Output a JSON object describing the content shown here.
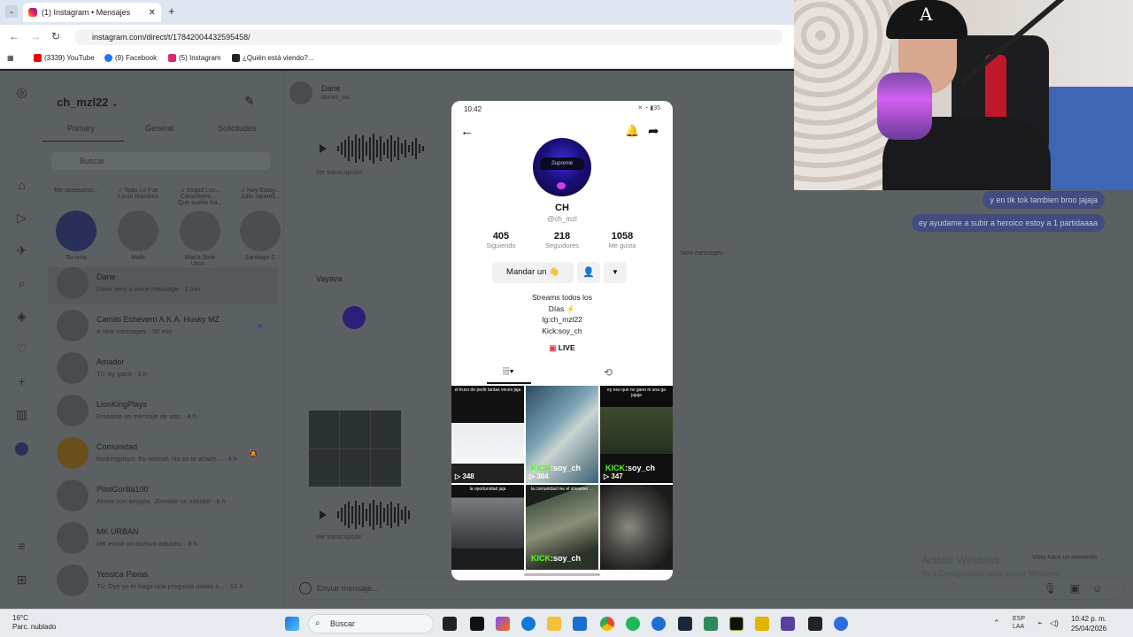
{
  "browser": {
    "tab_title": "(1) Instagram • Mensajes",
    "url": "instagram.com/direct/t/17842004432595458/",
    "bookmarks": [
      "(3339) YouTube",
      "(9) Facebook",
      "(5) Instagram",
      "¿Quién está viendo?..."
    ]
  },
  "instagram": {
    "account": "ch_mzl22",
    "tabs": [
      "Primary",
      "General",
      "Solicitudes"
    ],
    "search_placeholder": "Buscar",
    "notes": [
      {
        "bubble": "Me obsesiono...",
        "name": "Tu nota"
      },
      {
        "bubble": "♫ Todo Lo Fue Lenin Ramírez",
        "name": "Mafe"
      },
      {
        "bubble": "♫ Stupid Lov... Carselbero, ... Que sueño tra...",
        "name": "María José Urco..."
      },
      {
        "bubble": "♫ Hoy Estoy... Julio Jaramil...",
        "name": "Santiago C"
      }
    ],
    "conversations": [
      {
        "name": "Dane",
        "preview": "Dane sent a voice message · 1 min",
        "unread": false
      },
      {
        "name": "Camilo Echeverri A.K.A. Husky MZ",
        "preview": "4 new messages · 50 min",
        "unread": true
      },
      {
        "name": "Amador",
        "preview": "Tú: Ay gano · 3 h",
        "unread": false
      },
      {
        "name": "LionKingPlays",
        "preview": "Enviaste un mensaje de voz. · 4 h",
        "unread": false
      },
      {
        "name": "Comunidad",
        "preview": "lionkingplays: Es normal. No se le añade... · 4 h",
        "unread": false
      },
      {
        "name": "PilotGorilla100",
        "preview": "Ahora son amigos. ¡Envíale un saludo! · 6 h",
        "unread": false
      },
      {
        "name": "MK URBAN",
        "preview": "MK envió un archivo adjunto. · 8 h",
        "unread": false
      },
      {
        "name": "Yessica Pavas",
        "preview": "Tú: Oye yo te hago una pregunta quitas s... · 12 h",
        "unread": false
      }
    ],
    "chat": {
      "name": "Dane",
      "subtitle": "danez_wo",
      "transcription": "Ver transcripción",
      "sent_messages": [
        "y en tik tok tambien broo jajaja",
        "ey ayudame a subir a heroico estoy a 1 partidaaaa"
      ],
      "new_messages": "New messages",
      "shared_profile_label": "Vayava",
      "input_placeholder": "Enviar mensaje..."
    },
    "windows_watermark": {
      "line1": "Activar Windows",
      "line2": "Ve a Configuración para activar Windows.",
      "side": "Visto hace un momento"
    }
  },
  "phone": {
    "time": "10:42",
    "battery": "35",
    "name": "CH",
    "handle": "@ch_mzl",
    "stats": [
      {
        "value": "405",
        "label": "Siguiendo"
      },
      {
        "value": "218",
        "label": "Seguidores"
      },
      {
        "value": "1058",
        "label": "Me gusta"
      }
    ],
    "message_button": "Mandar un 👋",
    "bio": [
      "Streams todos los",
      "Días ⚡",
      "Ig:ch_mzl22",
      "Kick:soy_ch"
    ],
    "live_label": "LIVE",
    "avatar_text": "Supreme",
    "videos": [
      {
        "caption": "el truco de pedir tantas veces jaja",
        "views": "348",
        "kick": ""
      },
      {
        "caption": "",
        "views": "304",
        "kick": ":soy_ch"
      },
      {
        "caption": "ey eso que no gano ni una ga jajaja",
        "views": "347",
        "kick": ":soy_ch"
      },
      {
        "caption": "la oportunidad jaja",
        "views": "",
        "kick": ""
      },
      {
        "caption": "la comunidad me el streamer ...",
        "views": "",
        "kick": ":soy_ch"
      },
      {
        "caption": "",
        "views": "",
        "kick": ""
      }
    ],
    "kick_word": "KICK"
  },
  "webcam": {
    "cap_letter": "A"
  },
  "taskbar": {
    "temp": "16°C",
    "weather": "Parc. nublado",
    "search": "Buscar",
    "lang1": "ESP",
    "lang2": "LAA",
    "time": "10:42 p. m.",
    "date": "25/04/2026"
  }
}
